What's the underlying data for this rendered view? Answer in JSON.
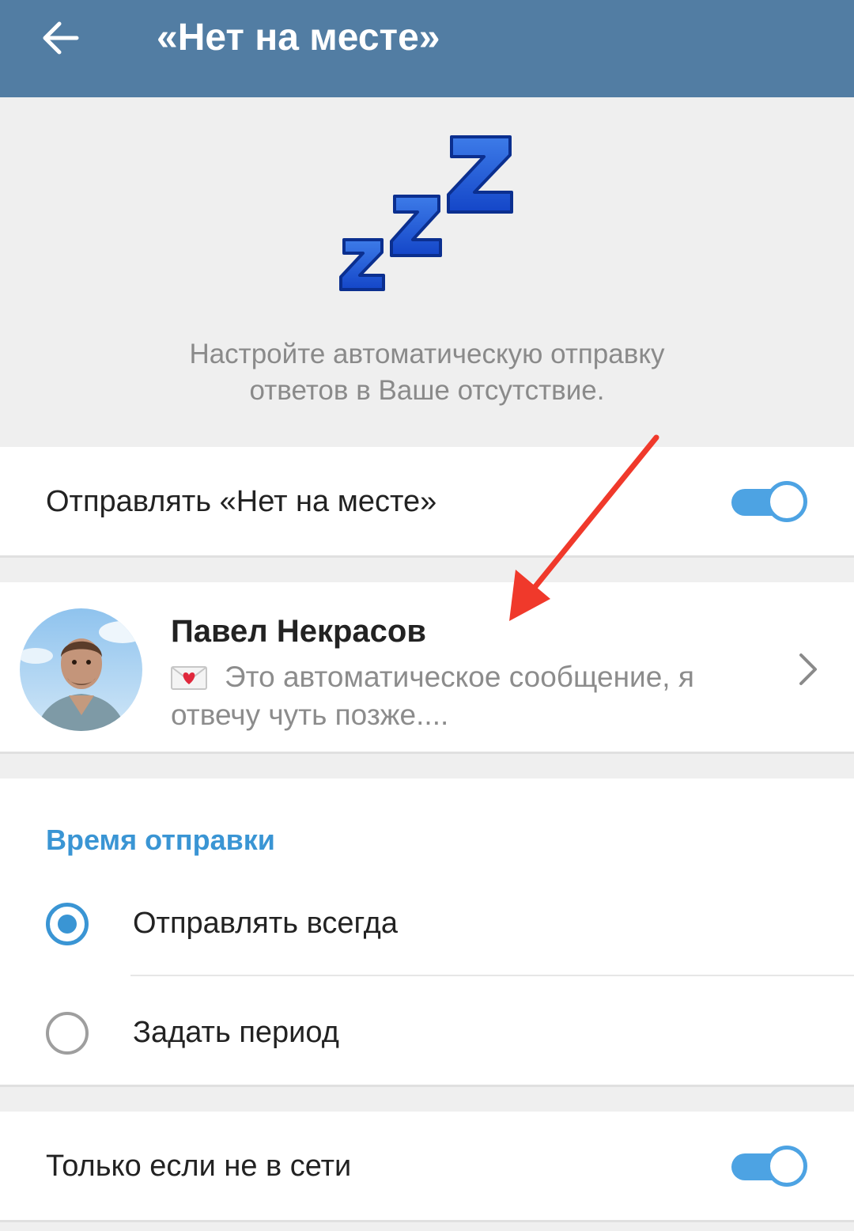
{
  "appbar": {
    "title": "«Нет на месте»",
    "back_icon": "arrow-left-icon",
    "background": "#527da3"
  },
  "hero": {
    "icon": "zzz-sleeping-icon",
    "description": "Настройте автоматическую отправку ответов в Ваше отсутствие."
  },
  "send_away": {
    "label": "Отправлять «Нет на месте»",
    "enabled": true
  },
  "message_preview": {
    "contact_name": "Павел Некрасов",
    "emoji_icon": "love-letter-icon",
    "message": "Это автоматическое сообщение, я отвечу чуть позже...."
  },
  "schedule": {
    "section_title": "Время отправки",
    "options": [
      {
        "label": "Отправлять всегда",
        "selected": true
      },
      {
        "label": "Задать период",
        "selected": false
      }
    ]
  },
  "only_offline": {
    "label": "Только если не в сети",
    "enabled": true
  },
  "colors": {
    "accent": "#3a95d4",
    "toggle": "#4da3e3",
    "annotation_arrow": "#f0392b"
  }
}
